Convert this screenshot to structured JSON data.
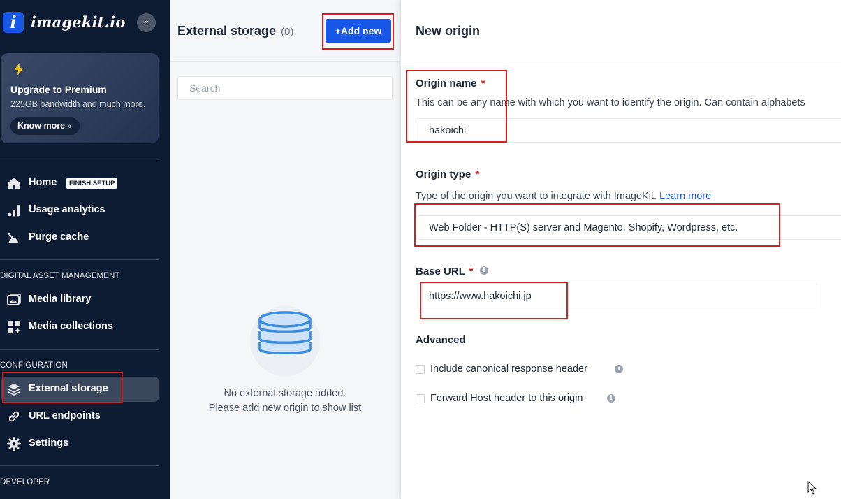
{
  "sidebar": {
    "logo_letter": "i",
    "logo_text": "imagekit.io",
    "collapse_icon": "«",
    "upgrade": {
      "title_prefix": "Upgrade to ",
      "title_emphasis": "Premium",
      "subtitle": "225GB bandwidth and much more.",
      "cta": "Know more",
      "cta_chevron": "»"
    },
    "nav_main": [
      {
        "label": "Home",
        "icon": "home-icon",
        "badge": "FINISH SETUP"
      },
      {
        "label": "Usage analytics",
        "icon": "bar-chart-icon"
      },
      {
        "label": "Purge cache",
        "icon": "broom-icon"
      }
    ],
    "section_dam": "DIGITAL ASSET MANAGEMENT",
    "nav_dam": [
      {
        "label": "Media library",
        "icon": "image-icon"
      },
      {
        "label": "Media collections",
        "icon": "collections-icon"
      }
    ],
    "section_config": "CONFIGURATION",
    "nav_config": [
      {
        "label": "External storage",
        "icon": "layers-icon",
        "active": true
      },
      {
        "label": "URL endpoints",
        "icon": "link-icon"
      },
      {
        "label": "Settings",
        "icon": "gear-icon"
      }
    ],
    "section_developer": "DEVELOPER"
  },
  "storage": {
    "title": "External storage",
    "count": "(0)",
    "add_button": "+Add new",
    "search_placeholder": "Search",
    "empty_line1": "No external storage added.",
    "empty_line2": "Please add new origin to show list"
  },
  "form": {
    "title": "New origin",
    "origin_name_label": "Origin name",
    "required_mark": "*",
    "origin_name_help": "This can be any name with which you want to identify the origin. Can contain alphabets",
    "origin_name_value": "hakoichi",
    "origin_type_label": "Origin type",
    "origin_type_help": "Type of the origin you want to integrate with ImageKit.",
    "origin_type_link": "Learn more",
    "origin_type_value": "Web Folder - HTTP(S) server and Magento, Shopify, Wordpress, etc.",
    "base_url_label": "Base URL",
    "base_url_value": "https://www.hakoichi.jp",
    "advanced_label": "Advanced",
    "checkbox_canonical": "Include canonical response header",
    "checkbox_forward_host": "Forward Host header to this origin",
    "info_glyph": "i"
  },
  "colors": {
    "sidebar_bg": "#0d1b33",
    "brand_blue": "#1856e6",
    "required_red": "#e02424",
    "annotation_red": "#d62020"
  }
}
